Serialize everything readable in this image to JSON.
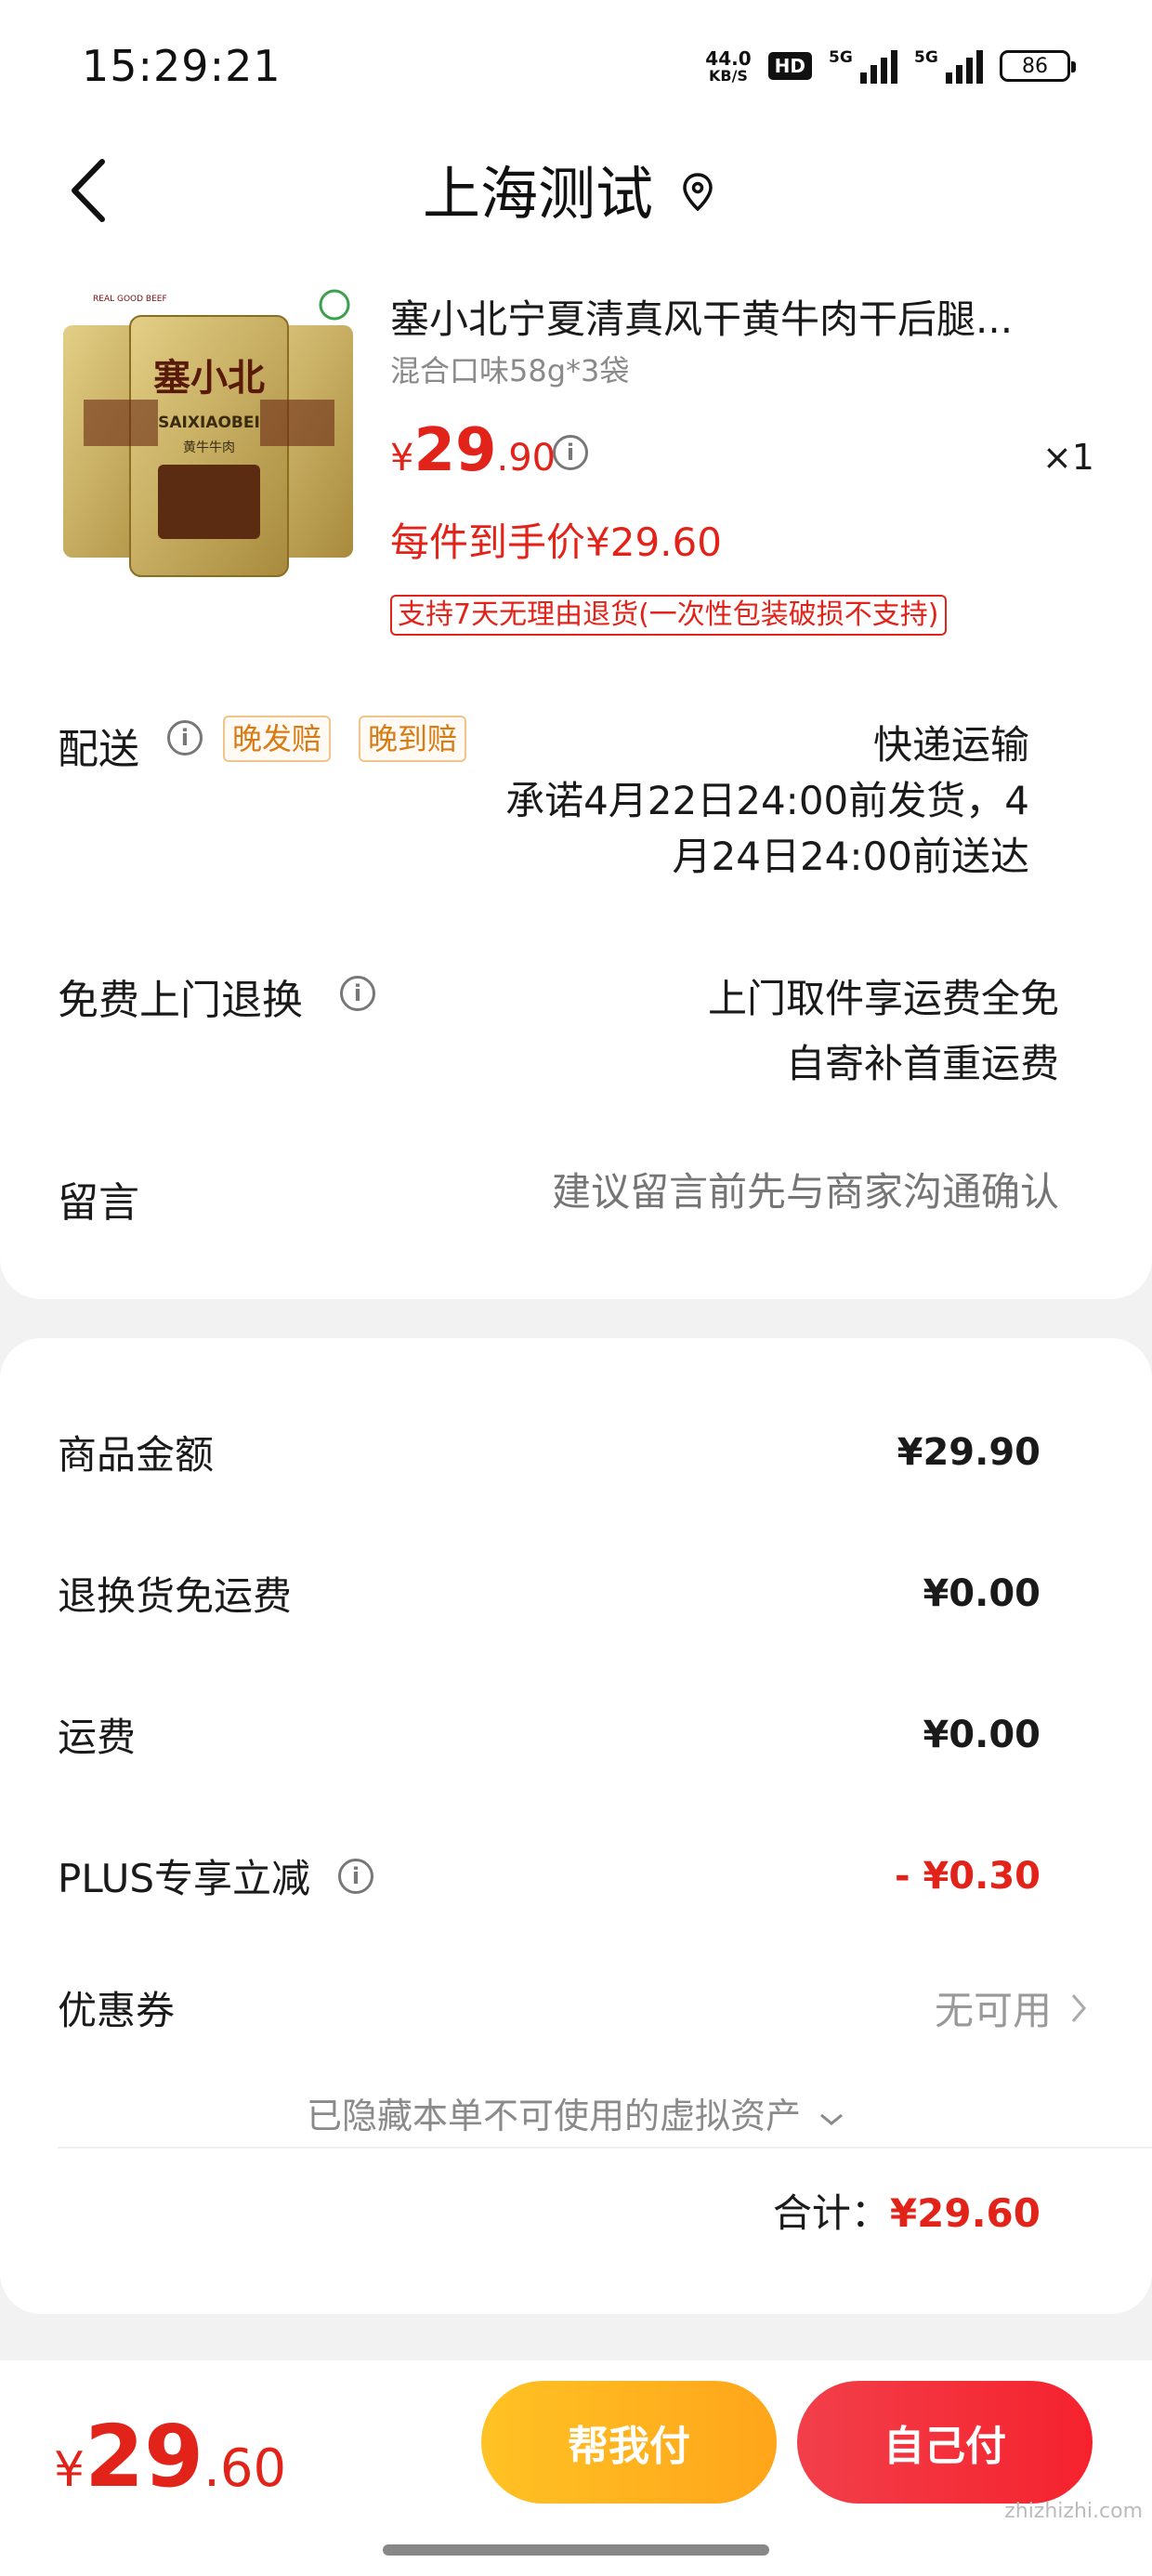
{
  "status_bar": {
    "time": "15:29:21",
    "net_speed_value": "44.0",
    "net_speed_unit": "KB/S",
    "hd_label": "HD",
    "sim1_label": "5G",
    "sim2_label": "5G",
    "battery_level": "86"
  },
  "header": {
    "title": "上海测试",
    "back_icon": "chevron-left-icon",
    "location_icon": "location-pin-icon"
  },
  "product": {
    "title": "塞小北宁夏清真风干黄牛肉干后腿...",
    "spec": "混合口味58g*3袋",
    "price_currency": "¥",
    "price_int": "29",
    "price_dec": ".90",
    "quantity": "×1",
    "per_item_price": "每件到手价¥29.60",
    "return_policy": "支持7天无理由退货(一次性包装破损不支持)",
    "image_texts": {
      "brand": "塞小北",
      "brand_pinyin": "SAIXIAOBEI",
      "product_type": "黄牛牛肉",
      "badge": "REAL GOOD BEEF"
    }
  },
  "delivery": {
    "label": "配送",
    "tag_late_ship": "晚发赔",
    "tag_late_arrive": "晚到赔",
    "method": "快递运输",
    "promise_line1": "承诺4月22日24:00前发货，4",
    "promise_line2": "月24日24:00前送达"
  },
  "free_return": {
    "label": "免费上门退换",
    "line1": "上门取件享运费全免",
    "line2": "自寄补首重运费"
  },
  "message": {
    "label": "留言",
    "placeholder": "建议留言前先与商家沟通确认"
  },
  "fees": {
    "goods_label": "商品金额",
    "goods_value": "¥29.90",
    "return_label": "退换货免运费",
    "return_value": "¥0.00",
    "shipping_label": "运费",
    "shipping_value": "¥0.00",
    "plus_label": "PLUS专享立减",
    "plus_value": "- ¥0.30",
    "coupon_label": "优惠券",
    "coupon_value": "无可用",
    "hidden_assets": "已隐藏本单不可使用的虚拟资产",
    "total_label": "合计：",
    "total_value": "¥29.60"
  },
  "bottom": {
    "currency": "¥",
    "price_int": "29",
    "price_dec": ".60",
    "help_pay": "帮我付",
    "self_pay": "自己付",
    "watermark": "zhizhizhi.com"
  },
  "colors": {
    "accent_red": "#e2231a",
    "tag_orange": "#d97a12",
    "help_btn": "#ffb51f",
    "self_btn": "#f3323c"
  }
}
